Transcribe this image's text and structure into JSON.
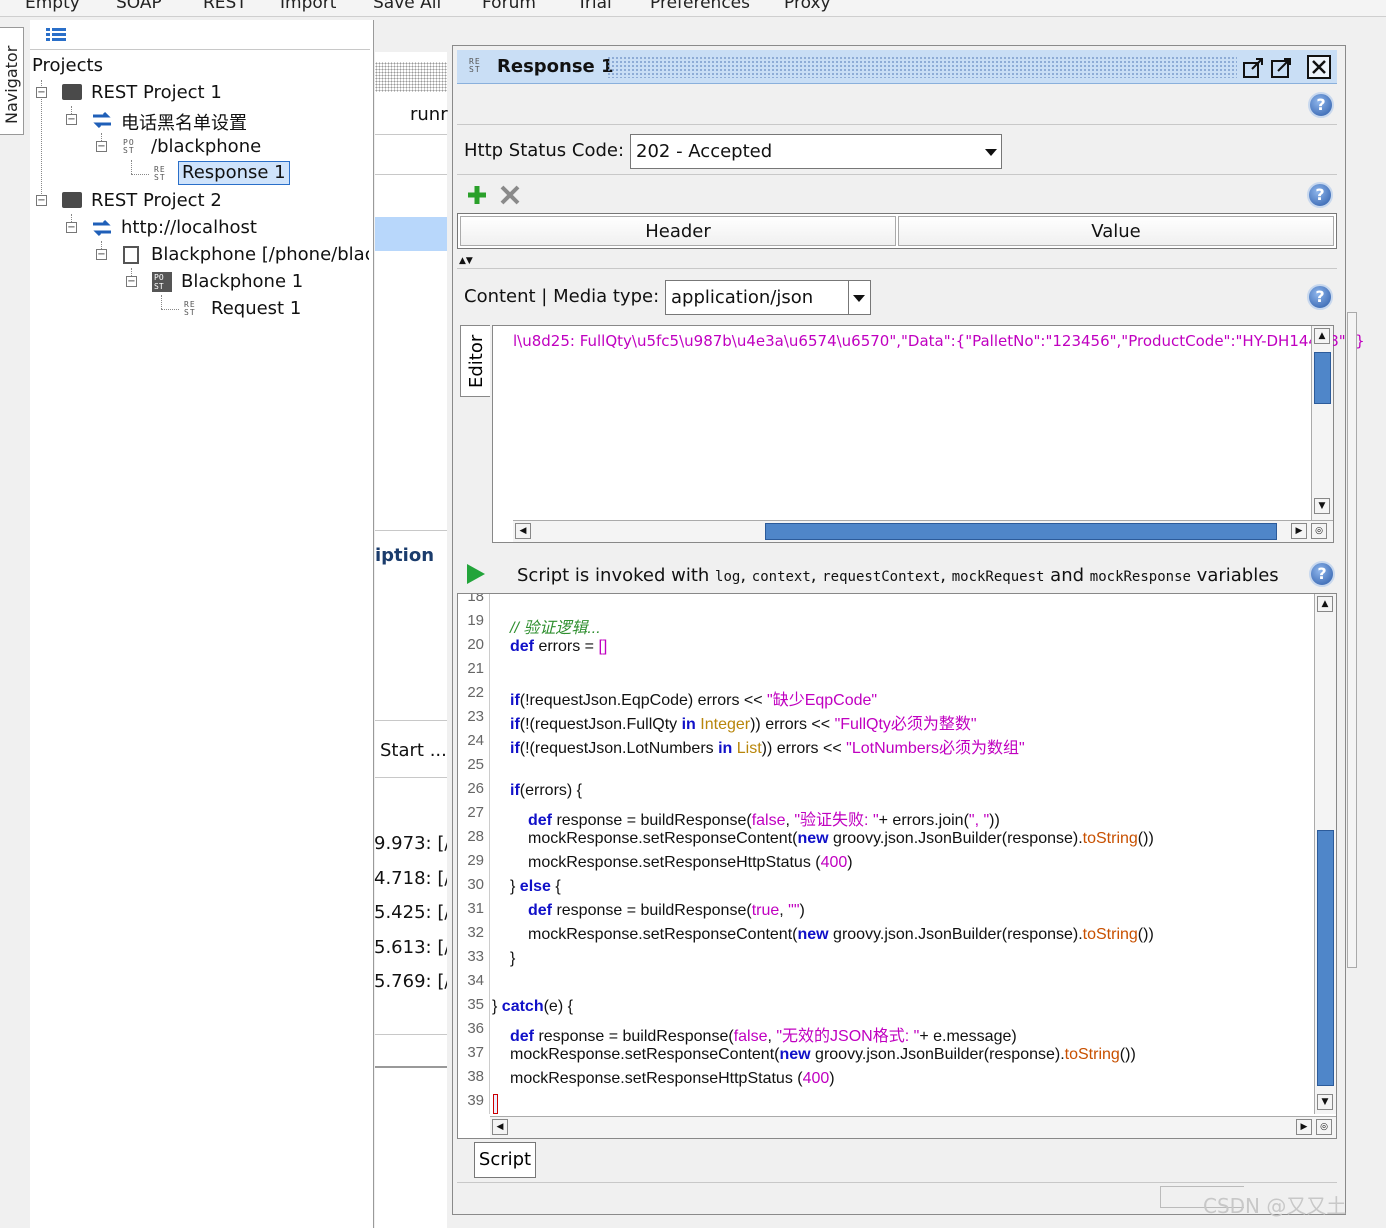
{
  "toolbar": {
    "items": [
      "Empty",
      "SOAP",
      "REST",
      "Import",
      "Save All",
      "Forum",
      "Trial",
      "Preferences",
      "Proxy"
    ]
  },
  "navigator": {
    "tab_label": "Navigator"
  },
  "tree": {
    "root_label": "Projects",
    "nodes": [
      {
        "label": "REST Project 1",
        "icon": "folder-icon"
      },
      {
        "label": "电话黑名单设置",
        "icon": "rest-service-icon"
      },
      {
        "label": "/blackphone",
        "icon": "post-resource-icon"
      },
      {
        "label": "Response 1",
        "icon": "rest-response-icon",
        "selected": true
      },
      {
        "label": "REST Project 2",
        "icon": "folder-icon"
      },
      {
        "label": "http://localhost",
        "icon": "rest-service-icon"
      },
      {
        "label": "Blackphone [/phone/blac",
        "icon": "resource-icon"
      },
      {
        "label": "Blackphone 1",
        "icon": "method-icon"
      },
      {
        "label": "Request 1",
        "icon": "rest-request-icon"
      }
    ]
  },
  "background_panel": {
    "runr": "runr",
    "iption": "iption",
    "start": "Start ...",
    "log_rows": [
      "9.973: [/l",
      "4.718: [/l",
      "5.425: [/l",
      "5.613: [/l",
      "5.769: [/l"
    ]
  },
  "response_window": {
    "title": "Response 1",
    "status_label": "Http Status Code:",
    "status_value": "202 - Accepted",
    "table_headers": [
      "Header",
      "Value"
    ],
    "content_label": "Content | Media type:",
    "media_type": "application/json",
    "editor_tab": "Editor",
    "editor_text": "l\\u8d25: FullQty\\u5fc5\\u987b\\u4e3a\\u6574\\u6570\",\"Data\":{\"PalletNo\":\"123456\",\"ProductCode\":\"HY-DH144N8\"}}",
    "script_info_prefix": "Script is invoked with",
    "script_vars": [
      "log",
      "context",
      "requestContext",
      "mockRequest",
      "mockResponse"
    ],
    "script_info_and": "and",
    "script_info_suffix": "variables",
    "script_tab": "Script"
  },
  "code": {
    "line_numbers": [
      "18",
      "19",
      "20",
      "21",
      "22",
      "23",
      "24",
      "25",
      "26",
      "27",
      "28",
      "29",
      "30",
      "31",
      "32",
      "33",
      "34",
      "35",
      "36",
      "37",
      "38",
      "39"
    ]
  },
  "watermark": "CSDN @又又土",
  "colors": {
    "accent": "#4f86c9",
    "title_bar": "#c9def5",
    "keyword": "#1010c8",
    "string": "#c000c0"
  }
}
